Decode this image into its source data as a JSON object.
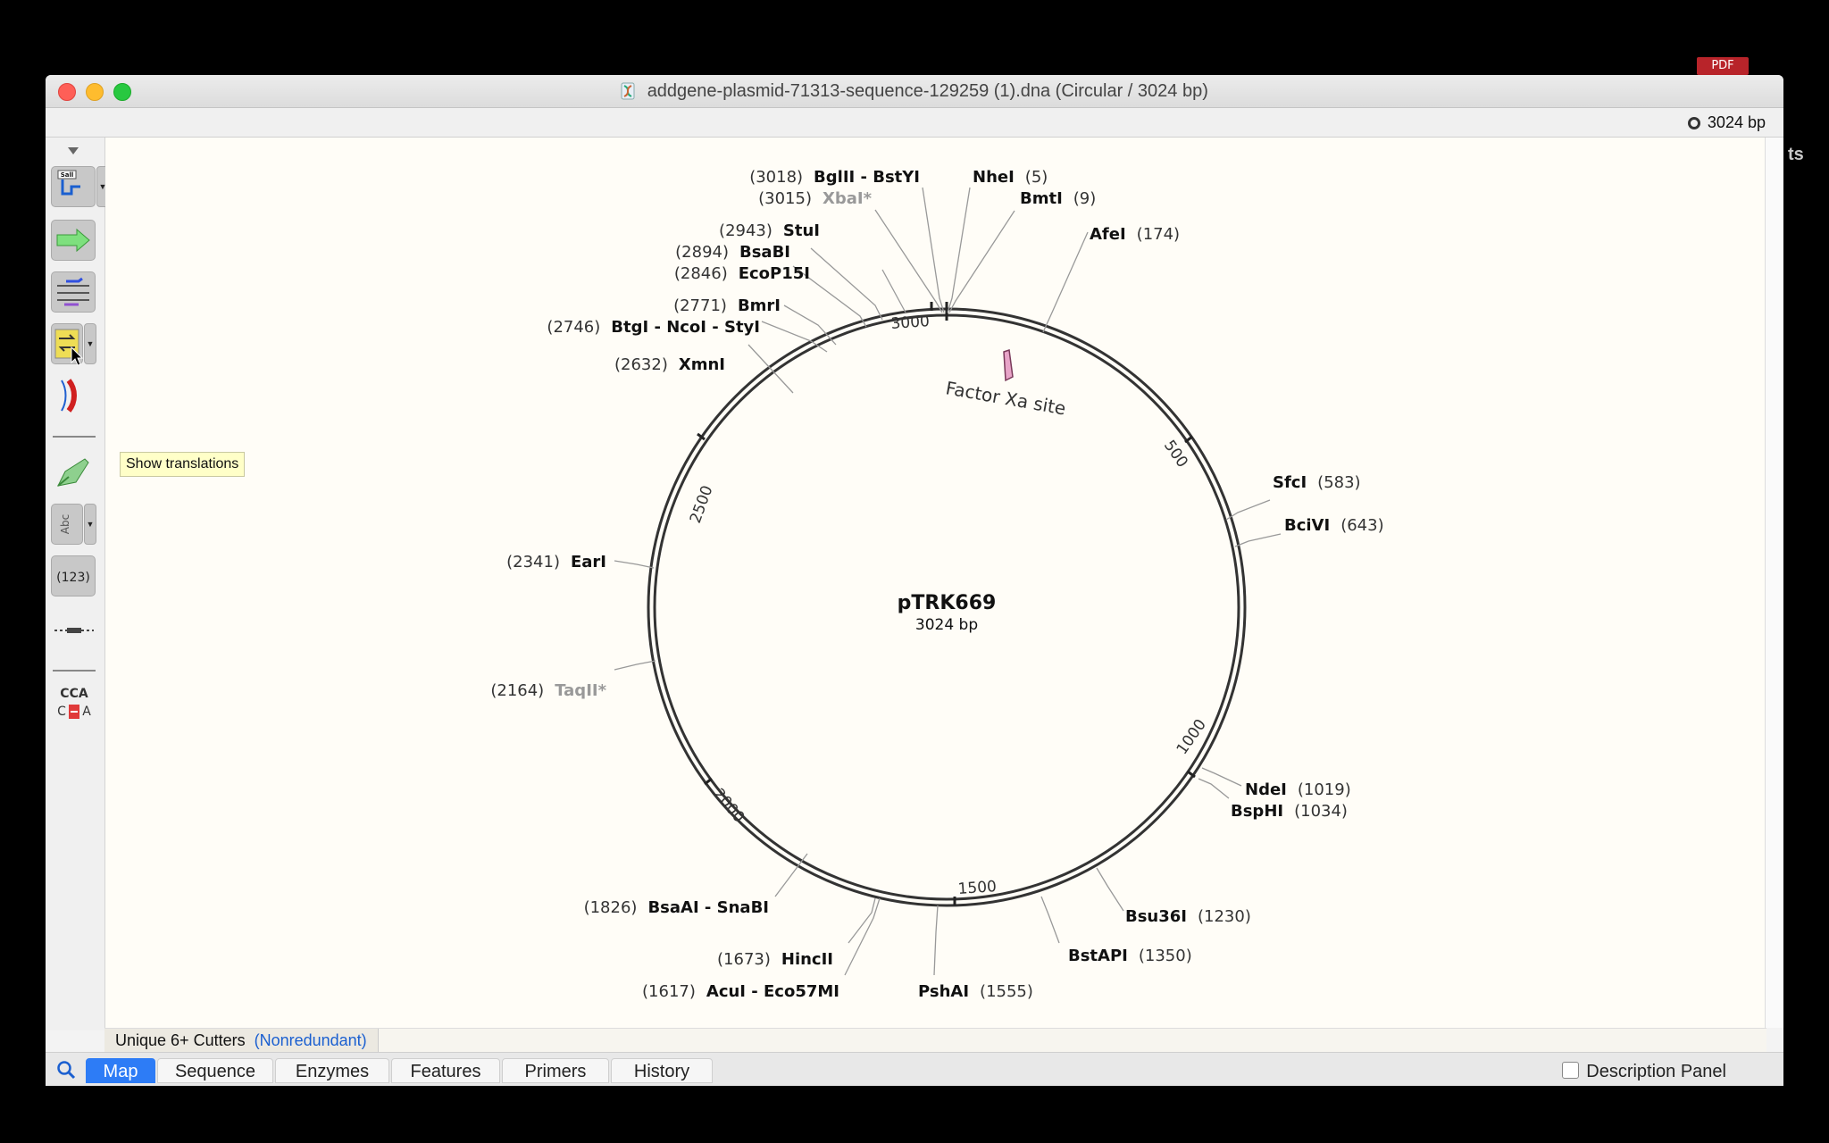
{
  "desktop": {
    "pdf_badge": "PDF",
    "bg_text": "ts"
  },
  "window": {
    "title": "addgene-plasmid-71313-sequence-129259 (1).dna  (Circular / 3024 bp)",
    "bp_readout": "3024 bp"
  },
  "toolbar": {
    "tooltip": "Show translations",
    "enzyme_btn_label": "Sall",
    "text_btn_label": "Abc",
    "numbers_btn_label": "(123)",
    "codon_top": "CCA",
    "codon_bottom_left": "C",
    "codon_bottom_right": "A"
  },
  "map": {
    "plasmid_name": "pTRK669",
    "plasmid_length": "3024 bp",
    "feature_label": "Factor Xa site",
    "ticks": [
      "3000",
      "500",
      "1000",
      "1500",
      "2000",
      "2500"
    ],
    "enzymes": [
      {
        "pos": "(3018)",
        "name": "BglII - BstYI"
      },
      {
        "pos": "(3015)",
        "name": "XbaI*"
      },
      {
        "pos": "(2943)",
        "name": "StuI"
      },
      {
        "pos": "(2894)",
        "name": "BsaBI"
      },
      {
        "pos": "(2846)",
        "name": "EcoP15I"
      },
      {
        "pos": "(2771)",
        "name": "BmrI"
      },
      {
        "pos": "(2746)",
        "name": "BtgI - NcoI - StyI"
      },
      {
        "pos": "(2632)",
        "name": "XmnI"
      },
      {
        "pos": "(5)",
        "name": "NheI"
      },
      {
        "pos": "(9)",
        "name": "BmtI"
      },
      {
        "pos": "(174)",
        "name": "AfeI"
      },
      {
        "pos": "(583)",
        "name": "SfcI"
      },
      {
        "pos": "(643)",
        "name": "BciVI"
      },
      {
        "pos": "(2341)",
        "name": "EarI"
      },
      {
        "pos": "(2164)",
        "name": "TaqII*"
      },
      {
        "pos": "(1019)",
        "name": "NdeI"
      },
      {
        "pos": "(1034)",
        "name": "BspHI"
      },
      {
        "pos": "(1230)",
        "name": "Bsu36I"
      },
      {
        "pos": "(1350)",
        "name": "BstAPI"
      },
      {
        "pos": "(1555)",
        "name": "PshAI"
      },
      {
        "pos": "(1826)",
        "name": "BsaAI - SnaBI"
      },
      {
        "pos": "(1673)",
        "name": "HincII"
      },
      {
        "pos": "(1617)",
        "name": "AcuI - Eco57MI"
      }
    ]
  },
  "status": {
    "cutters_label": "Unique 6+ Cutters",
    "cutters_mode": "(Nonredundant)"
  },
  "tabs": [
    "Map",
    "Sequence",
    "Enzymes",
    "Features",
    "Primers",
    "History"
  ],
  "description_panel": "Description Panel",
  "colors": {
    "active_tab": "#2d7cf6",
    "map_background": "#fffdf7",
    "nonredundant_link": "#1a5fd0"
  }
}
